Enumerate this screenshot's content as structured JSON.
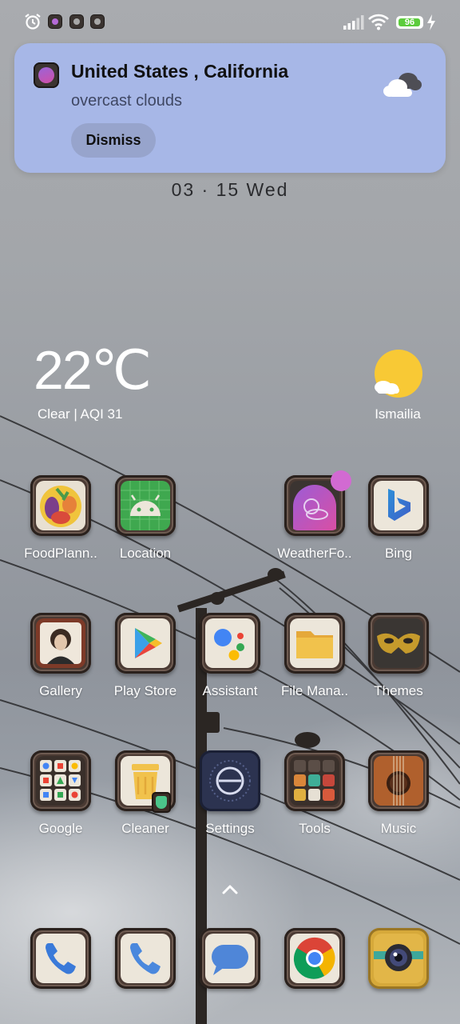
{
  "status_bar": {
    "battery_level": "96",
    "battery_fraction": 0.96,
    "icons": [
      "alarm-icon",
      "weather-app-icon",
      "tools-app-icon",
      "settings-app-icon",
      "signal-icon",
      "wifi-icon",
      "battery-icon",
      "charging-icon"
    ]
  },
  "notification": {
    "title": "United States , California",
    "body": "overcast clouds",
    "dismiss_label": "Dismiss",
    "icon": "cloud-icon"
  },
  "date": "03 · 15 Wed",
  "weather": {
    "temperature": "22℃",
    "condition": "Clear | AQI 31",
    "city": "Ismailia",
    "icon": "sun-icon"
  },
  "home": {
    "row1": [
      {
        "label": "FoodPlann..",
        "icon": "food-planner-icon"
      },
      {
        "label": "Location",
        "icon": "android-icon"
      },
      {
        "label": "WeatherFo..",
        "icon": "weather-forecast-icon"
      },
      {
        "label": "Bing",
        "icon": "bing-icon"
      }
    ],
    "row2": [
      {
        "label": "Gallery",
        "icon": "gallery-icon"
      },
      {
        "label": "Play Store",
        "icon": "play-store-icon"
      },
      {
        "label": "Assistant",
        "icon": "assistant-icon"
      },
      {
        "label": "File Mana..",
        "icon": "folder-icon"
      },
      {
        "label": "Themes",
        "icon": "mask-icon"
      }
    ],
    "row3": [
      {
        "label": "Google",
        "icon": "google-folder-icon"
      },
      {
        "label": "Cleaner",
        "icon": "trash-bin-icon"
      },
      {
        "label": "Settings",
        "icon": "settings-icon"
      },
      {
        "label": "Tools",
        "icon": "tools-folder-icon"
      },
      {
        "label": "Music",
        "icon": "guitar-icon"
      }
    ],
    "dock": [
      {
        "icon": "phone-icon"
      },
      {
        "icon": "phone-icon"
      },
      {
        "icon": "messages-icon"
      },
      {
        "icon": "chrome-icon"
      },
      {
        "icon": "camera-icon"
      }
    ]
  },
  "colors": {
    "notification_bg": "#a7b7e7",
    "dismiss_bg": "#97a4cc",
    "battery_green": "#5ccc3c",
    "badge_pink": "#d26ad2"
  }
}
